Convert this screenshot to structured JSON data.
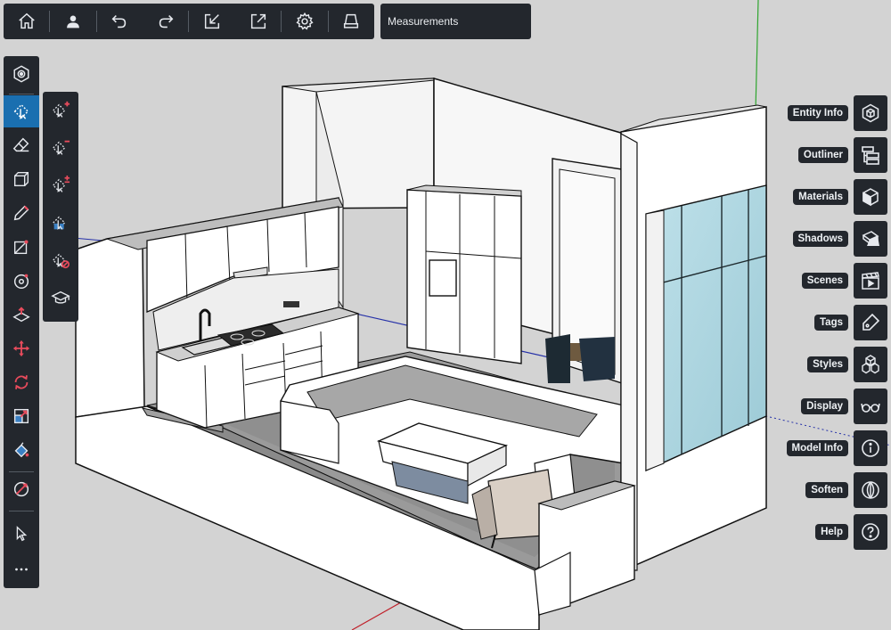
{
  "top_toolbar": {
    "buttons": [
      {
        "name": "home",
        "icon": "home-icon"
      },
      {
        "name": "account",
        "icon": "user-icon"
      },
      {
        "name": "undo",
        "icon": "undo-icon"
      },
      {
        "name": "redo",
        "icon": "redo-icon"
      },
      {
        "name": "import",
        "icon": "import-icon"
      },
      {
        "name": "export",
        "icon": "export-icon"
      },
      {
        "name": "settings",
        "icon": "gear-icon"
      },
      {
        "name": "ar-viewer",
        "icon": "tray-icon"
      }
    ]
  },
  "measurements": {
    "label": "Measurements"
  },
  "left_toolbar": {
    "tools": [
      {
        "name": "search",
        "icon": "hexagon-search-icon"
      },
      {
        "name": "select",
        "icon": "select-arrow-icon",
        "active": true
      },
      {
        "name": "eraser",
        "icon": "eraser-icon"
      },
      {
        "name": "rectangle-3d",
        "icon": "box-outline-icon"
      },
      {
        "name": "pencil",
        "icon": "pencil-icon"
      },
      {
        "name": "line",
        "icon": "line-tool-icon"
      },
      {
        "name": "circle",
        "icon": "circle-tool-icon"
      },
      {
        "name": "push-pull",
        "icon": "push-pull-icon"
      },
      {
        "name": "move",
        "icon": "move-icon"
      },
      {
        "name": "rotate",
        "icon": "rotate-icon"
      },
      {
        "name": "scale",
        "icon": "scale-icon"
      },
      {
        "name": "paint-bucket",
        "icon": "paint-bucket-icon"
      },
      {
        "name": "orbit",
        "icon": "orbit-icon"
      },
      {
        "name": "pointer",
        "icon": "pointer-icon"
      },
      {
        "name": "more",
        "icon": "more-dots-icon"
      }
    ]
  },
  "select_flyout": {
    "items": [
      {
        "name": "select-add",
        "icon": "select-plus-icon"
      },
      {
        "name": "select-subtract",
        "icon": "select-minus-icon"
      },
      {
        "name": "select-toggle",
        "icon": "select-plusminus-icon"
      },
      {
        "name": "select-filter",
        "icon": "select-filter-icon"
      },
      {
        "name": "select-none",
        "icon": "select-none-icon"
      },
      {
        "name": "select-advanced",
        "icon": "select-hat-icon"
      }
    ]
  },
  "right_panel": {
    "items": [
      {
        "label": "Entity Info",
        "icon": "entity-info-icon"
      },
      {
        "label": "Outliner",
        "icon": "outliner-icon"
      },
      {
        "label": "Materials",
        "icon": "materials-cube-icon"
      },
      {
        "label": "Shadows",
        "icon": "shadows-icon"
      },
      {
        "label": "Scenes",
        "icon": "scenes-clapper-icon"
      },
      {
        "label": "Tags",
        "icon": "tag-icon"
      },
      {
        "label": "Styles",
        "icon": "styles-cubes-icon"
      },
      {
        "label": "Display",
        "icon": "glasses-icon"
      },
      {
        "label": "Model Info",
        "icon": "info-icon"
      },
      {
        "label": "Soften",
        "icon": "soften-sphere-icon"
      },
      {
        "label": "Help",
        "icon": "help-icon"
      }
    ]
  },
  "colors": {
    "toolbar_bg": "#23272d",
    "active_tool": "#1a6fb0",
    "icon_fg": "#e6e9ee",
    "canvas_bg": "#d2d2d2",
    "axis_red": "#c0202a",
    "axis_green": "#2fa52f",
    "axis_blue": "#2530a8"
  }
}
